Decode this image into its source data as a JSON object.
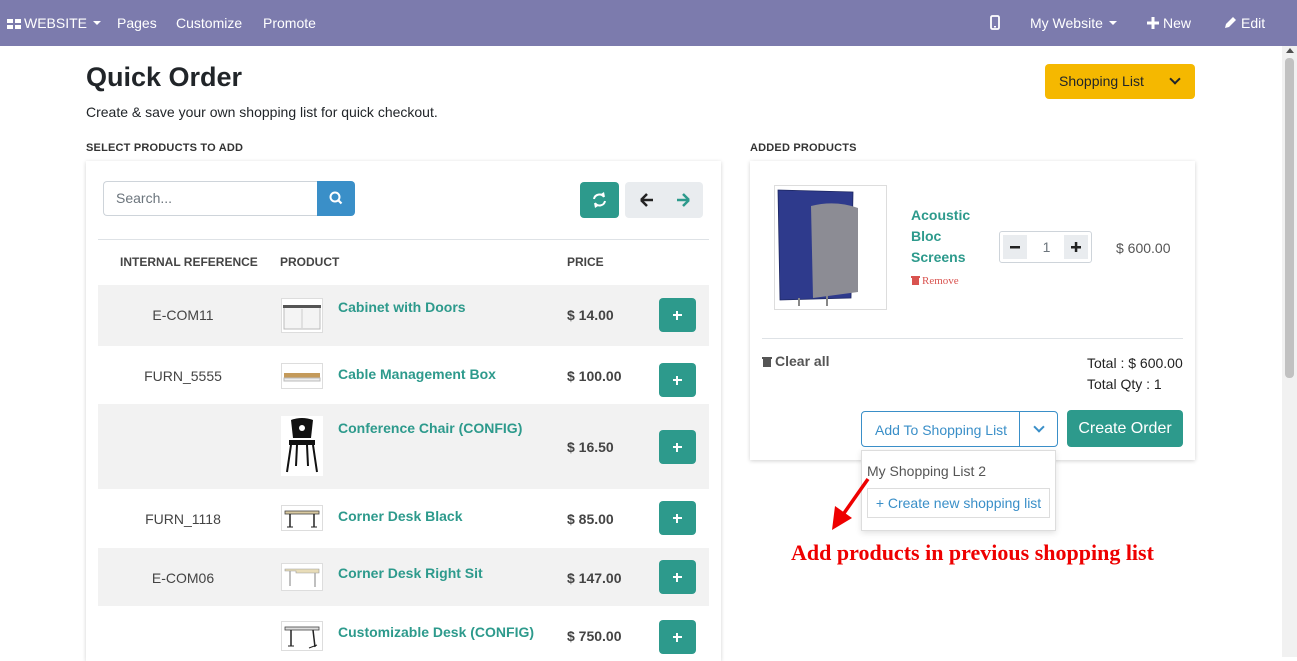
{
  "topbar": {
    "website": "WEBSITE",
    "pages": "Pages",
    "customize": "Customize",
    "promote": "Promote",
    "my_website": "My Website",
    "new": "New",
    "edit": "Edit"
  },
  "header": {
    "title": "Quick Order",
    "subtitle": "Create & save your own shopping list for quick checkout.",
    "shopping_list_button": "Shopping List"
  },
  "select_products": {
    "section_label": "SELECT PRODUCTS TO ADD",
    "search_placeholder": "Search...",
    "columns": [
      "INTERNAL REFERENCE",
      "PRODUCT",
      "PRICE"
    ],
    "rows": [
      {
        "ref": "E-COM11",
        "name": "Cabinet with Doors",
        "price": "$ 14.00"
      },
      {
        "ref": "FURN_5555",
        "name": "Cable Management Box",
        "price": "$ 100.00"
      },
      {
        "ref": "",
        "name": "Conference Chair (CONFIG)",
        "price": "$ 16.50"
      },
      {
        "ref": "FURN_1118",
        "name": "Corner Desk Black",
        "price": "$ 85.00"
      },
      {
        "ref": "E-COM06",
        "name": "Corner Desk Right Sit",
        "price": "$ 147.00"
      },
      {
        "ref": "",
        "name": "Customizable Desk (CONFIG)",
        "price": "$ 750.00"
      }
    ]
  },
  "added_products": {
    "section_label": "ADDED PRODUCTS",
    "item": {
      "name": "Acoustic Bloc Screens",
      "remove": "Remove",
      "qty": "1",
      "price": "$ 600.00"
    },
    "clear_all": "Clear all",
    "total": "Total : $ 600.00",
    "total_qty": "Total Qty : 1",
    "add_to_shopping_list": "Add To Shopping List",
    "create_order": "Create Order",
    "dropdown": {
      "existing_list": "My Shopping List 2",
      "create_new": "+ Create new shopping list"
    }
  },
  "annotation": "Add products in previous shopping list",
  "colors": {
    "topbar": "#7c7bad",
    "teal": "#2d9a8c",
    "blue": "#3a8fc8",
    "yellow": "#f5b800",
    "annotation_red": "#ee0000"
  }
}
